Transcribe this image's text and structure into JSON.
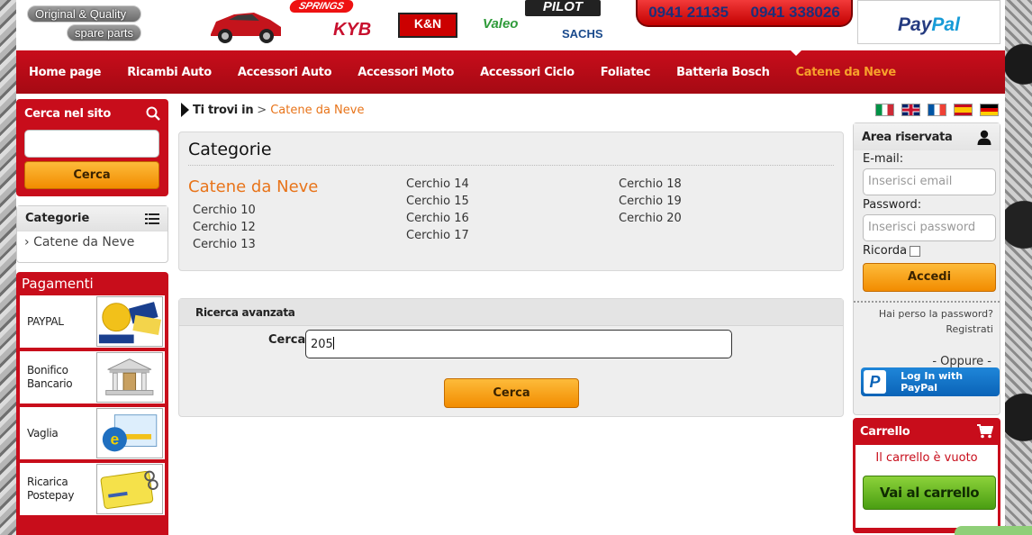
{
  "header": {
    "slogan_line1": "Original & Quality",
    "slogan_line2": "spare parts",
    "brands": {
      "springs": "SPRINGS",
      "kyb": "KYB",
      "kn": "K&N",
      "valeo": "Valeo",
      "pilot": "PILOT",
      "sachs": "SACHS"
    },
    "phone1": "0941 21135",
    "phone2": "0941 338026",
    "paypal_logo_a": "Pay",
    "paypal_logo_b": "Pal"
  },
  "nav": {
    "items": [
      {
        "label": "Home page"
      },
      {
        "label": "Ricambi Auto"
      },
      {
        "label": "Accessori Auto"
      },
      {
        "label": "Accessori Moto"
      },
      {
        "label": "Accessori Ciclo"
      },
      {
        "label": "Foliatec"
      },
      {
        "label": "Batteria Bosch"
      },
      {
        "label": "Catene da Neve"
      }
    ],
    "active_index": 7
  },
  "sidebar_left": {
    "search_title": "Cerca nel sito",
    "search_button": "Cerca",
    "categories_title": "Categorie",
    "category_item": "Catene da Neve",
    "payments_title": "Pagamenti",
    "payments": [
      {
        "label": "PAYPAL",
        "icon": "paypal-verified-icon"
      },
      {
        "label": "Bonifico Bancario",
        "icon": "bank-icon"
      },
      {
        "label": "Vaglia",
        "icon": "postal-order-icon"
      },
      {
        "label": "Ricarica Postepay",
        "icon": "postepay-card-icon"
      }
    ]
  },
  "breadcrumb": {
    "label": "Ti trovi in",
    "separator": ">",
    "current": "Catene da Neve"
  },
  "categories_panel": {
    "title": "Categorie",
    "main_category": "Catene da Neve",
    "col1": [
      "Cerchio 10",
      "Cerchio 12",
      "Cerchio 13"
    ],
    "col2": [
      "Cerchio 14",
      "Cerchio 15",
      "Cerchio 16",
      "Cerchio 17"
    ],
    "col3": [
      "Cerchio 18",
      "Cerchio 19",
      "Cerchio 20"
    ]
  },
  "advanced_search": {
    "title": "Ricerca avanzata",
    "field_label": "Cerca",
    "field_value": "205",
    "button": "Cerca"
  },
  "login": {
    "title": "Area riservata",
    "email_label": "E-mail:",
    "email_placeholder": "Inserisci email",
    "password_label": "Password:",
    "password_placeholder": "Inserisci password",
    "remember_label": "Ricorda",
    "submit": "Accedi",
    "forgot": "Hai perso la password?",
    "register": "Registrati",
    "or": "- Oppure -",
    "paypal_login": "Log In with PayPal"
  },
  "cart": {
    "title": "Carrello",
    "empty_text": "Il carrello è vuoto",
    "button": "Vai al carrello"
  },
  "colors": {
    "brand_red": "#c80d1b",
    "accent_orange": "#e8741a",
    "button_orange": "#f28c00",
    "button_green": "#4a9e12"
  }
}
